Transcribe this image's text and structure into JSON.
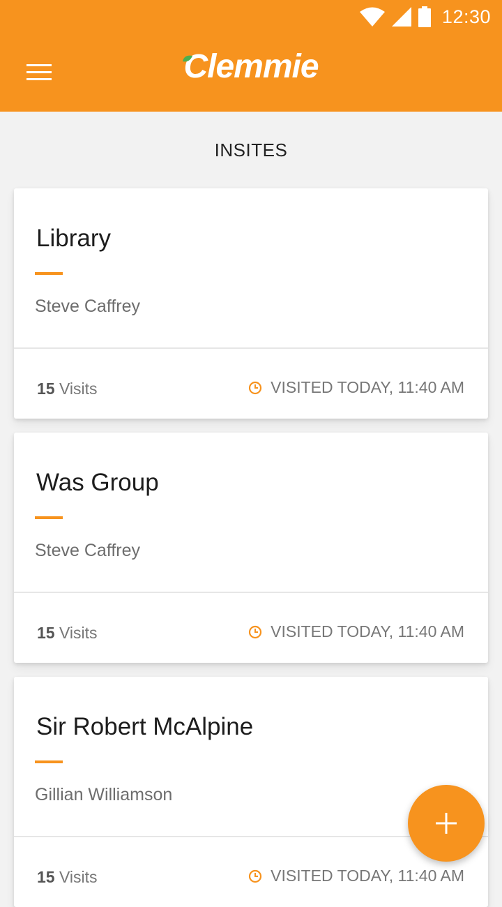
{
  "status_bar": {
    "time": "12:30",
    "icons": [
      "wifi-icon",
      "signal-icon",
      "battery-icon"
    ]
  },
  "header": {
    "menu_icon": "hamburger-menu-icon",
    "logo_text": "Clemmie"
  },
  "section": {
    "title": "INSITES"
  },
  "cards": [
    {
      "title": "Library",
      "person": "Steve Caffrey",
      "visits_count": "15",
      "visits_label": "Visits",
      "visited": "VISITED TODAY, 11:40 AM"
    },
    {
      "title": "Was Group",
      "person": "Steve Caffrey",
      "visits_count": "15",
      "visits_label": "Visits",
      "visited": "VISITED TODAY, 11:40 AM"
    },
    {
      "title": "Sir Robert McAlpine",
      "person": "Gillian Williamson",
      "visits_count": "15",
      "visits_label": "Visits",
      "visited": "VISITED TODAY, 11:40 AM"
    }
  ],
  "fab": {
    "icon": "plus-icon"
  },
  "colors": {
    "primary": "#f7931e",
    "background": "#f2f2f2",
    "card": "#ffffff",
    "leaf": "#4caf50"
  }
}
